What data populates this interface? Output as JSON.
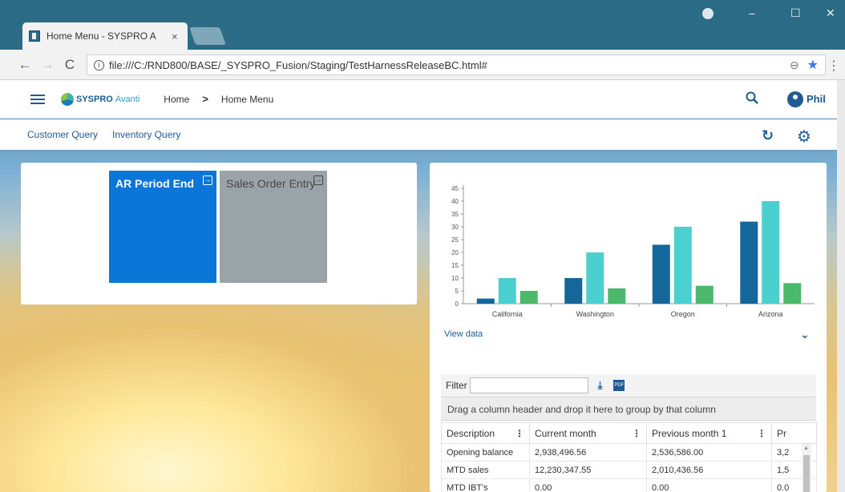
{
  "browser": {
    "tab_title": "Home Menu - SYSPRO A",
    "tab_close": "×",
    "url": "file:///C:/RND800/BASE/_SYSPRO_Fusion/Staging/TestHarnessReleaseBC.html#",
    "info_icon_text": "i"
  },
  "header": {
    "logo_brand": "SYSPRO",
    "logo_product": "Avanti",
    "breadcrumb_home": "Home",
    "breadcrumb_sep": ">",
    "breadcrumb_current": "Home Menu",
    "user_name": "Phil"
  },
  "subnav": {
    "links": [
      "Customer Query",
      "Inventory Query"
    ]
  },
  "tiles": [
    {
      "label": "AR Period End",
      "color": "#0a76d8"
    },
    {
      "label": "Sales Order Entry",
      "color": "#9aa3a7"
    }
  ],
  "chart": {
    "view_data_label": "View data"
  },
  "chart_data": {
    "type": "bar",
    "categories": [
      "California",
      "Washington",
      "Oregon",
      "Arizona"
    ],
    "series": [
      {
        "color": "#15679b",
        "values": [
          2,
          10,
          23,
          32
        ]
      },
      {
        "color": "#4ccfcf",
        "values": [
          10,
          20,
          30,
          40
        ]
      },
      {
        "color": "#4cb86b",
        "values": [
          5,
          6,
          7,
          8
        ]
      }
    ],
    "ylim": [
      0,
      45
    ],
    "yticks": [
      0,
      5,
      10,
      15,
      20,
      25,
      30,
      35,
      40,
      45
    ],
    "title": "",
    "xlabel": "",
    "ylabel": "",
    "grid": false
  },
  "grid": {
    "filter_label": "Filter",
    "pdf_label": "PDF",
    "group_hint": "Drag a column header and drop it here to group by that column",
    "columns": [
      "Description",
      "Current month",
      "Previous month 1",
      "Pr"
    ],
    "rows": [
      [
        "Opening balance",
        "2,938,496.56",
        "2,536,586.00",
        "3,2"
      ],
      [
        "MTD sales",
        "12,230,347.55",
        "2,010,436.56",
        "1,5"
      ],
      [
        "MTD IBT's",
        "0.00",
        "0.00",
        "0.0"
      ]
    ]
  }
}
